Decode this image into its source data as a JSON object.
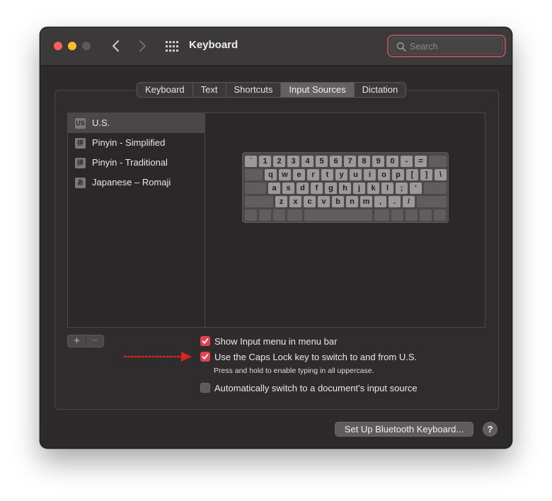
{
  "window": {
    "title": "Keyboard"
  },
  "search": {
    "placeholder": "Search",
    "value": ""
  },
  "tabs": [
    {
      "label": "Keyboard",
      "active": false
    },
    {
      "label": "Text",
      "active": false
    },
    {
      "label": "Shortcuts",
      "active": false
    },
    {
      "label": "Input Sources",
      "active": true
    },
    {
      "label": "Dictation",
      "active": false
    }
  ],
  "input_sources": [
    {
      "icon_text": "US",
      "icon": "us-flag-icon",
      "label": "U.S.",
      "selected": true
    },
    {
      "icon_text": "拼",
      "icon": "pinyin-icon",
      "label": "Pinyin - Simplified",
      "selected": false
    },
    {
      "icon_text": "拼",
      "icon": "pinyin-icon",
      "label": "Pinyin - Traditional",
      "selected": false
    },
    {
      "icon_text": "あ",
      "icon": "hiragana-icon",
      "label": "Japanese – Romaji",
      "selected": false
    }
  ],
  "keyboard_preview": {
    "row1": [
      "`",
      "1",
      "2",
      "3",
      "4",
      "5",
      "6",
      "7",
      "8",
      "9",
      "0",
      "-",
      "="
    ],
    "row2": [
      "q",
      "w",
      "e",
      "r",
      "t",
      "y",
      "u",
      "i",
      "o",
      "p",
      "[",
      "]",
      "\\"
    ],
    "row3": [
      "a",
      "s",
      "d",
      "f",
      "g",
      "h",
      "j",
      "k",
      "l",
      ";",
      "'"
    ],
    "row4": [
      "z",
      "x",
      "c",
      "v",
      "b",
      "n",
      "m",
      ",",
      ".",
      "/"
    ]
  },
  "list_controls": {
    "add_label": "+",
    "remove_label": "−"
  },
  "options": {
    "show_input_menu": {
      "label": "Show Input menu in menu bar",
      "checked": true
    },
    "caps_lock_switch": {
      "label": "Use the Caps Lock key to switch to and from U.S.",
      "checked": true,
      "sublabel": "Press and hold to enable typing in all uppercase."
    },
    "auto_switch": {
      "label": "Automatically switch to a document’s input source",
      "checked": false
    }
  },
  "footer": {
    "bluetooth_button": "Set Up Bluetooth Keyboard...",
    "help_label": "?"
  },
  "colors": {
    "accent": "#e0424f",
    "annotation_arrow": "#d8261b",
    "search_focus_ring": "#a8505e"
  }
}
